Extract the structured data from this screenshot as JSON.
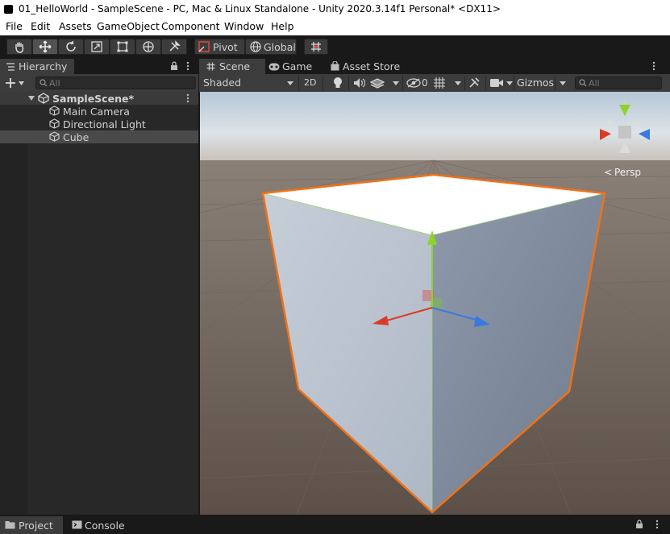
{
  "window": {
    "title": "01_HelloWorld - SampleScene - PC, Mac & Linux Standalone - Unity 2020.3.14f1 Personal* <DX11>"
  },
  "menu": [
    "File",
    "Edit",
    "Assets",
    "GameObject",
    "Component",
    "Window",
    "Help"
  ],
  "toolbar": {
    "tools": [
      "hand-tool-icon",
      "move-tool-icon",
      "rotate-tool-icon",
      "scale-tool-icon",
      "rect-tool-icon",
      "transform-tool-icon",
      "custom-tool-icon"
    ],
    "pivot_label": "Pivot",
    "global_label": "Global"
  },
  "hierarchy": {
    "tab_label": "Hierarchy",
    "search_placeholder": "All",
    "scene_name": "SampleScene*",
    "items": [
      "Main Camera",
      "Directional Light",
      "Cube"
    ],
    "selected_item": "Cube"
  },
  "scene_view": {
    "tabs": [
      "Scene",
      "Game",
      "Asset Store"
    ],
    "active_tab": "Scene",
    "draw_mode": "Shaded",
    "mode_2d_label": "2D",
    "hidden_count": "0",
    "gizmos_label": "Gizmos",
    "search_placeholder": "All",
    "projection_label": "Persp",
    "gizmo_axes": {
      "x": "x",
      "y": "y",
      "z": "z"
    }
  },
  "bottom": {
    "tabs": [
      "Project",
      "Console"
    ]
  },
  "colors": {
    "selection_outline": "#f07218",
    "x_axis": "#db3b26",
    "y_axis": "#8bd42a",
    "z_axis": "#3a7ae0",
    "panel_bg": "#282828",
    "toolbar_bg": "#3c3c3c"
  }
}
